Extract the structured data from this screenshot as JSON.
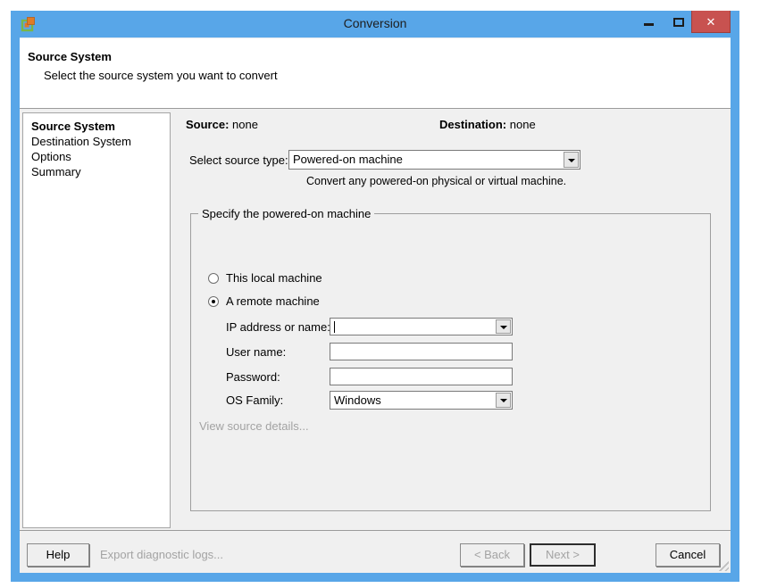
{
  "window": {
    "title": "Conversion",
    "close_glyph": "✕"
  },
  "header": {
    "title": "Source System",
    "subtitle": "Select the source system you want to convert"
  },
  "sidebar": {
    "items": [
      {
        "label": "Source System",
        "active": true
      },
      {
        "label": "Destination System",
        "active": false
      },
      {
        "label": "Options",
        "active": false
      },
      {
        "label": "Summary",
        "active": false
      }
    ]
  },
  "status": {
    "source_label": "Source:",
    "source_value": "none",
    "destination_label": "Destination:",
    "destination_value": "none"
  },
  "source_type": {
    "label": "Select source type:",
    "selected": "Powered-on machine",
    "description": "Convert any powered-on physical or virtual machine."
  },
  "machine_group": {
    "title": "Specify the powered-on machine",
    "radio_local": {
      "label": "This local machine",
      "selected": false
    },
    "radio_remote": {
      "label": "A remote machine",
      "selected": true
    },
    "fields": {
      "ip": {
        "label": "IP address or name:",
        "value": ""
      },
      "user": {
        "label": "User name:",
        "value": ""
      },
      "password": {
        "label": "Password:",
        "value": ""
      },
      "os": {
        "label": "OS Family:",
        "value": "Windows"
      }
    },
    "details_link": "View source details..."
  },
  "footer": {
    "help": "Help",
    "export_logs": "Export diagnostic logs...",
    "back": "< Back",
    "next": "Next >",
    "cancel": "Cancel"
  },
  "colors": {
    "frame": "#58a6e8",
    "close_button": "#c85250",
    "content_bg": "#f0f0f0",
    "disabled_text": "#a3a3a3"
  }
}
